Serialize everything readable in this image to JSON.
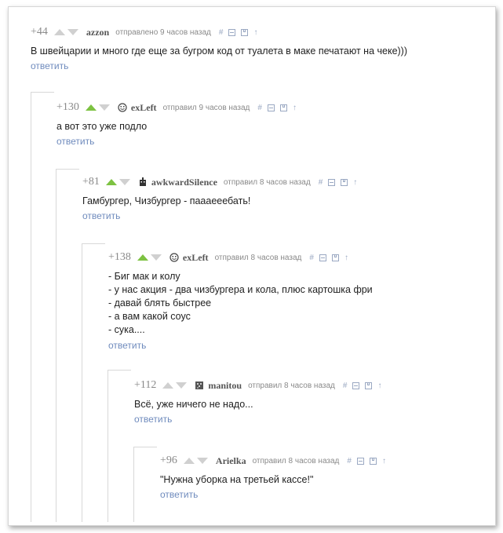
{
  "comments": [
    {
      "rating": "+44",
      "up_active": false,
      "author": "azzon",
      "avatar_icon": "none",
      "time": "отправлено 9 часов назад",
      "lines": [
        "В швейцарии и много где еще за бугром код от туалета в маке печатают на чеке)))"
      ],
      "reply": "ответить"
    },
    {
      "rating": "+130",
      "up_active": true,
      "author": "exLeft",
      "avatar_icon": "smiley-icon",
      "time": "отправил 9 часов назад",
      "lines": [
        "а вот это уже подло"
      ],
      "reply": "ответить"
    },
    {
      "rating": "+81",
      "up_active": true,
      "author": "awkwardSilence",
      "avatar_icon": "robot-avatar-icon",
      "time": "отправил 8 часов назад",
      "lines": [
        "Гамбургер, Чизбургер - паааееебать!"
      ],
      "reply": "ответить"
    },
    {
      "rating": "+138",
      "up_active": true,
      "author": "exLeft",
      "avatar_icon": "smiley-icon",
      "time": "отправил 8 часов назад",
      "lines": [
        "- Биг мак и колу",
        "- у нас акция - два чизбургера и кола, плюс картошка фри",
        "- давай блять быстрее",
        "- а вам какой соус",
        "- сука...."
      ],
      "reply": "ответить"
    },
    {
      "rating": "+112",
      "up_active": false,
      "author": "manitou",
      "avatar_icon": "pixel-avatar-icon",
      "time": "отправил 8 часов назад",
      "lines": [
        "Всё, уже ничего не надо..."
      ],
      "reply": "ответить"
    },
    {
      "rating": "+96",
      "up_active": false,
      "author": "Arielka",
      "avatar_icon": "none",
      "time": "отправил 8 часов назад",
      "lines": [
        "\"Нужна уборка на третьей кассе!\""
      ],
      "reply": "ответить"
    }
  ],
  "tool_icons": [
    "hash-link-icon",
    "collapse-icon",
    "save-icon",
    "go-to-parent-icon"
  ],
  "tool_glyphs": {
    "hash": "#",
    "parent": "↑"
  },
  "colors": {
    "vote_active": "#7dc242",
    "link": "#6f8bbd",
    "meta": "#8a8a8a"
  }
}
